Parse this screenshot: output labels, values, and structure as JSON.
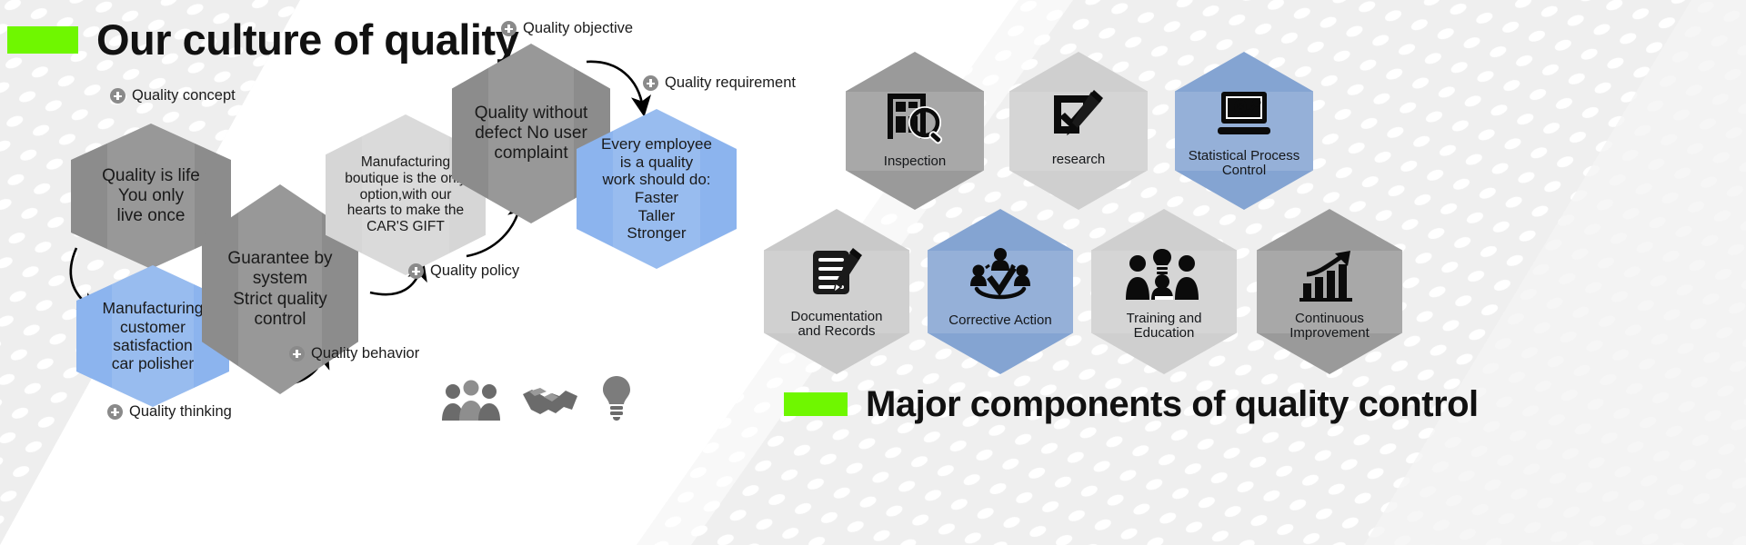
{
  "palette": {
    "green_accent": "#6ff700",
    "hex_dark_gray": "#8c8c8c",
    "hex_mid_gray": "#969696",
    "hex_light_gray": "#d6d6d6",
    "hex_blue": "#8cb4ee",
    "hex_blue_deep": "#84a4d2",
    "bg_pattern_gray": "#eeeeee",
    "text_dark": "#1a1a1a"
  },
  "left_panel": {
    "title": "Our culture of quality",
    "hexagons": [
      {
        "id": "quality-is-life",
        "text": "Quality is life\nYou only\nlive once",
        "color": "#8c8c8c"
      },
      {
        "id": "manufacturing-customer",
        "text": "Manufacturing\ncustomer\nsatisfaction\ncar polisher",
        "color": "#8cb4ee"
      },
      {
        "id": "guarantee-by-system",
        "text": "Guarantee by\nsystem\nStrict quality\ncontrol",
        "color": "#8c8c8c"
      },
      {
        "id": "manufacturing-boutique",
        "text": "Manufacturing\nboutique is the only\noption,with our\nhearts to make the\nCAR'S GIFT",
        "color": "#d6d6d6"
      },
      {
        "id": "quality-without-defect",
        "text": "Quality without\ndefect No user\ncomplaint",
        "color": "#8c8c8c"
      },
      {
        "id": "every-employee",
        "text": "Every employee\nis a quality\nwork should do:\nFaster\nTaller\nStronger",
        "color": "#8cb4ee"
      }
    ],
    "callouts": [
      {
        "id": "quality-concept",
        "label": "Quality concept"
      },
      {
        "id": "quality-thinking",
        "label": "Quality thinking"
      },
      {
        "id": "quality-behavior",
        "label": "Quality behavior"
      },
      {
        "id": "quality-policy",
        "label": "Quality  policy"
      },
      {
        "id": "quality-objective",
        "label": "Quality objective"
      },
      {
        "id": "quality-requirement",
        "label": "Quality requirement"
      }
    ],
    "trio_icons": [
      "people-group-icon",
      "handshake-icon",
      "lightbulb-icon"
    ]
  },
  "right_panel": {
    "title": "Major components of quality control",
    "items": [
      {
        "id": "inspection",
        "label": "Inspection",
        "icon": "inspection-magnifier-icon",
        "color": "#9a9a9a"
      },
      {
        "id": "research",
        "label": "research",
        "icon": "checklist-pen-icon",
        "color": "#cfcfcf"
      },
      {
        "id": "statistical-process-control",
        "label": "Statistical Process\nControl",
        "icon": "laptop-chart-icon",
        "color": "#84a4d2"
      },
      {
        "id": "documentation-and-records",
        "label": "Documentation\nand Records",
        "icon": "document-pencil-icon",
        "color": "#c9c9c9"
      },
      {
        "id": "corrective-action",
        "label": "Corrective Action",
        "icon": "team-check-icon",
        "color": "#84a4d2"
      },
      {
        "id": "training-and-education",
        "label": "Training and\nEducation",
        "icon": "training-people-icon",
        "color": "#cfcfcf"
      },
      {
        "id": "continuous-improvement",
        "label": "Continuous\nImprovement",
        "icon": "growth-bars-arrow-icon",
        "color": "#9a9a9a"
      }
    ]
  }
}
